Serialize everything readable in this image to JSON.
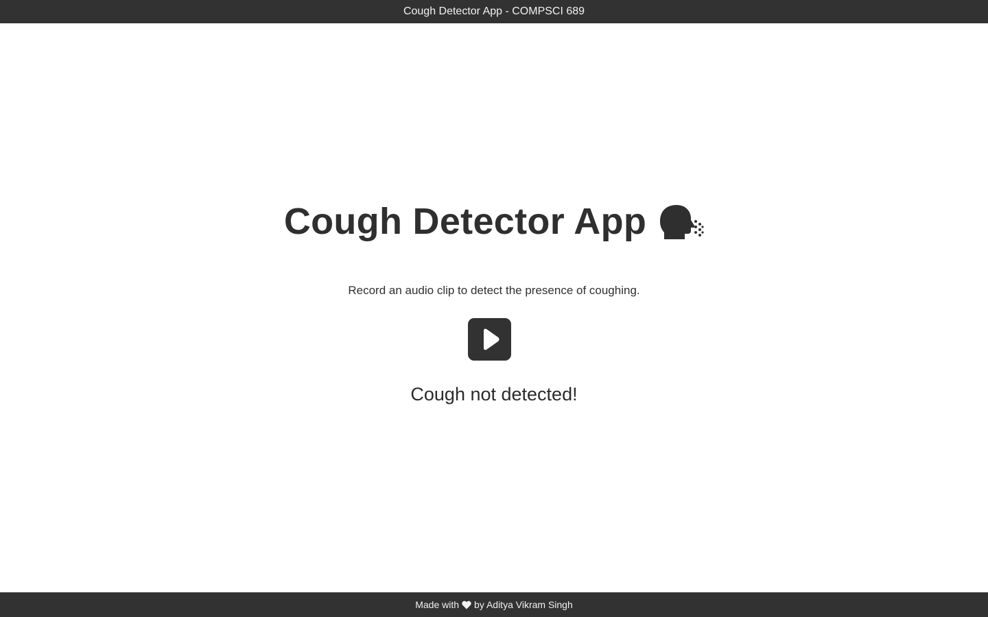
{
  "window": {
    "title": "Cough Detector App - COMPSCI 689"
  },
  "main": {
    "heading": "Cough Detector App",
    "heading_icon": "coughing-face-icon",
    "subtitle": "Record an audio clip to detect the presence of coughing.",
    "record_button_icon": "play-icon",
    "status": "Cough not detected!"
  },
  "footer": {
    "prefix": "Made with",
    "icon": "heart-icon",
    "suffix": "by Aditya Vikram Singh"
  },
  "colors": {
    "bar_background": "#323232",
    "page_background": "#ffffff",
    "text": "#2b2b2b",
    "button_background": "#323232"
  }
}
